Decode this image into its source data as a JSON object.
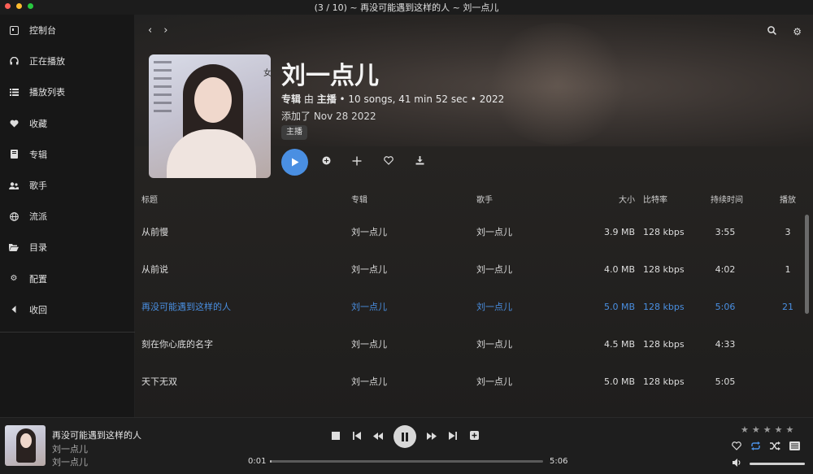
{
  "window": {
    "title": "(3 / 10) ~ 再没可能遇到这样的人 ~ 刘一点儿"
  },
  "sidebar": {
    "items": [
      {
        "label": "控制台",
        "icon": "dashboard-icon"
      },
      {
        "label": "正在播放",
        "icon": "headphones-icon"
      },
      {
        "label": "播放列表",
        "icon": "playlist-icon"
      },
      {
        "label": "收藏",
        "icon": "heart-icon"
      },
      {
        "label": "专辑",
        "icon": "album-icon"
      },
      {
        "label": "歌手",
        "icon": "artists-icon"
      },
      {
        "label": "流派",
        "icon": "globe-icon"
      },
      {
        "label": "目录",
        "icon": "folder-icon"
      },
      {
        "label": "配置",
        "icon": "gear-icon"
      },
      {
        "label": "收回",
        "icon": "collapse-icon"
      }
    ]
  },
  "album": {
    "title": "刘一点儿",
    "type_label": "专辑",
    "by_label": "由",
    "artist": "主播",
    "meta": "• 10 songs, 41 min 52 sec • 2022",
    "added": "添加了 Nov 28 2022",
    "tag": "主播",
    "cover_text": "女"
  },
  "table": {
    "headers": {
      "title": "标题",
      "album": "专辑",
      "artist": "歌手",
      "size": "大小",
      "bitrate": "比特率",
      "duration": "持续时间",
      "plays": "播放"
    },
    "rows": [
      {
        "title": "从前慢",
        "album": "刘一点儿",
        "artist": "刘一点儿",
        "size": "3.9 MB",
        "bitrate": "128 kbps",
        "duration": "3:55",
        "plays": "3"
      },
      {
        "title": "从前说",
        "album": "刘一点儿",
        "artist": "刘一点儿",
        "size": "4.0 MB",
        "bitrate": "128 kbps",
        "duration": "4:02",
        "plays": "1"
      },
      {
        "title": "再没可能遇到这样的人",
        "album": "刘一点儿",
        "artist": "刘一点儿",
        "size": "5.0 MB",
        "bitrate": "128 kbps",
        "duration": "5:06",
        "plays": "21"
      },
      {
        "title": "刻在你心底的名字",
        "album": "刘一点儿",
        "artist": "刘一点儿",
        "size": "4.5 MB",
        "bitrate": "128 kbps",
        "duration": "4:33",
        "plays": ""
      },
      {
        "title": "天下无双",
        "album": "刘一点儿",
        "artist": "刘一点儿",
        "size": "5.0 MB",
        "bitrate": "128 kbps",
        "duration": "5:05",
        "plays": ""
      }
    ],
    "active_row": 2
  },
  "player": {
    "title": "再没可能遇到这样的人",
    "artist": "刘一点儿",
    "album": "刘一点儿",
    "current_time": "0:01",
    "total_time": "5:06",
    "progress": 0.003,
    "volume": 1.0,
    "rating": 0,
    "accent_color": "#4a8fe2"
  }
}
